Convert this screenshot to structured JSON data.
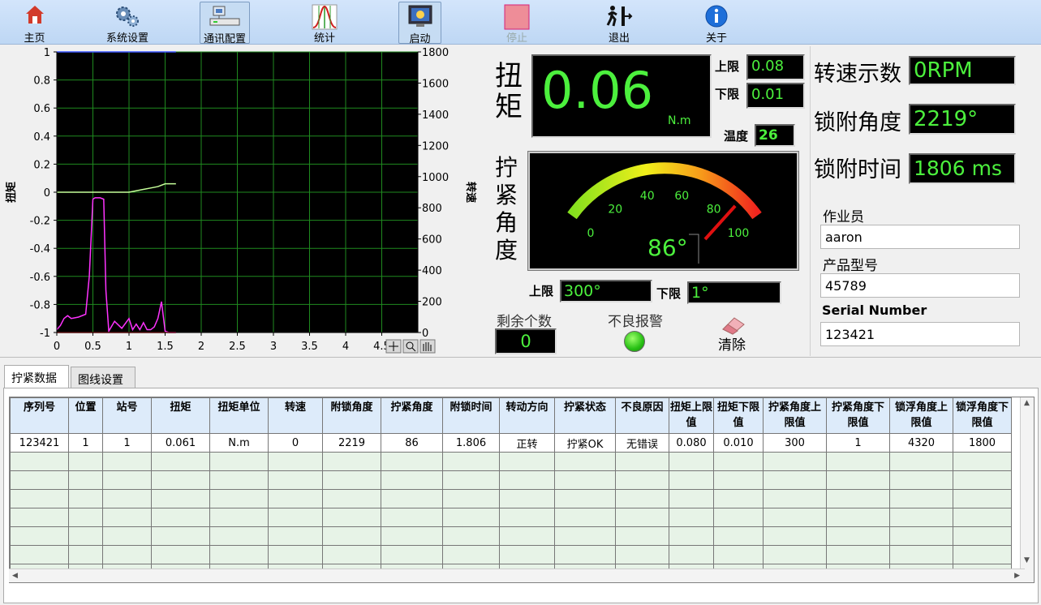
{
  "toolbar": {
    "items": [
      {
        "label": "主页",
        "icon": "home-icon"
      },
      {
        "label": "系统设置",
        "icon": "gears-icon"
      },
      {
        "label": "通讯配置",
        "icon": "network-config-icon"
      },
      {
        "label": "统计",
        "icon": "statistics-icon"
      },
      {
        "label": "启动",
        "icon": "start-monitor-icon"
      },
      {
        "label": "停止",
        "icon": "stop-icon"
      },
      {
        "label": "退出",
        "icon": "exit-icon"
      },
      {
        "label": "关于",
        "icon": "info-icon"
      }
    ]
  },
  "chart_data": {
    "type": "line",
    "xlabel": "",
    "ylabel": "扭矩",
    "y2label": "转速",
    "xlim": [
      0,
      5
    ],
    "ylim": [
      -1,
      1
    ],
    "y2lim": [
      0,
      1800
    ],
    "x_ticks": [
      "0",
      "0.5",
      "1",
      "1.5",
      "2",
      "2.5",
      "3",
      "3.5",
      "4",
      "4.5"
    ],
    "y_ticks": [
      "1",
      "0.8",
      "0.6",
      "0.4",
      "0.2",
      "0",
      "-0.2",
      "-0.4",
      "-0.6",
      "-0.8",
      "-1"
    ],
    "y2_ticks": [
      "1800",
      "1600",
      "1400",
      "1200",
      "1000",
      "800",
      "600",
      "400",
      "200",
      "0"
    ],
    "grid": true,
    "background": "#000000",
    "series": [
      {
        "color": "#c6ff9a",
        "axis": "left",
        "x": [
          0,
          0.3,
          0.5,
          0.7,
          0.85,
          1.0,
          1.1,
          1.2,
          1.3,
          1.4,
          1.5,
          1.55,
          1.65
        ],
        "y": [
          0.0,
          0.0,
          0.0,
          0.0,
          0.0,
          0.0,
          0.01,
          0.02,
          0.03,
          0.04,
          0.06,
          0.06,
          0.06
        ]
      },
      {
        "color": "#ff33ff",
        "axis": "left",
        "x": [
          0,
          0.05,
          0.1,
          0.15,
          0.2,
          0.3,
          0.4,
          0.45,
          0.5,
          0.53,
          0.6,
          0.65,
          0.68,
          0.72,
          0.8,
          0.9,
          1.0,
          1.05,
          1.1,
          1.15,
          1.2,
          1.25,
          1.3,
          1.35,
          1.4,
          1.45,
          1.5,
          1.55,
          1.6,
          1.65
        ],
        "y": [
          -0.98,
          -0.95,
          -0.9,
          -0.88,
          -0.9,
          -0.89,
          -0.87,
          -0.6,
          -0.05,
          -0.04,
          -0.04,
          -0.05,
          -0.7,
          -0.99,
          -0.92,
          -0.97,
          -0.9,
          -0.98,
          -0.94,
          -0.98,
          -0.93,
          -0.98,
          -0.98,
          -0.96,
          -0.9,
          -0.78,
          -0.99,
          -1.0,
          -1.0,
          -1.0
        ]
      },
      {
        "color": "#ff2a2a",
        "axis": "left",
        "x": [
          0,
          1.65
        ],
        "y": [
          -1.0,
          -1.0
        ]
      },
      {
        "color": "#3a57ff",
        "axis": "left",
        "x": [
          0,
          1.65
        ],
        "y": [
          1.0,
          1.0
        ]
      }
    ]
  },
  "torque": {
    "label": "扭矩",
    "value": "0.06",
    "unit": "N.m",
    "upper_label": "上限",
    "upper_value": "0.08",
    "lower_label": "下限",
    "lower_value": "0.01",
    "temp_label": "温度",
    "temp_value": "26"
  },
  "angle": {
    "label": "拧紧角度",
    "gauge_value": 86,
    "gauge_text": "86°",
    "gauge_ticks": [
      "0",
      "20",
      "40",
      "60",
      "80",
      "100"
    ],
    "upper_label": "上限",
    "upper_value": "300°",
    "lower_label": "下限",
    "lower_value": "1°"
  },
  "remaining": {
    "label": "剩余个数",
    "value": "0"
  },
  "alarm": {
    "label": "不良报警",
    "color": "#3ddc1a"
  },
  "clear": {
    "label": "清除",
    "icon": "eraser-icon"
  },
  "stats": {
    "speed_label": "转速示数",
    "speed_value": "0RPM",
    "lock_angle_label": "锁附角度",
    "lock_angle_value": "2219°",
    "lock_time_label": "锁附时间",
    "lock_time_value": "1806 ms"
  },
  "form": {
    "operator_label": "作业员",
    "operator_value": "aaron",
    "product_label": "产品型号",
    "product_value": "45789",
    "serial_label": "Serial Number",
    "serial_value": "123421"
  },
  "tabs": [
    {
      "label": "拧紧数据"
    },
    {
      "label": "图线设置"
    }
  ],
  "table": {
    "headers": [
      "序列号",
      "位置",
      "站号",
      "扭矩",
      "扭矩单位",
      "转速",
      "附锁角度",
      "拧紧角度",
      "附锁时间",
      "转动方向",
      "拧紧状态",
      "不良原因",
      "扭矩上限值",
      "扭矩下限值",
      "拧紧角度上限值",
      "拧紧角度下限值",
      "锁浮角度上限值",
      "锁浮角度下限值"
    ],
    "rows": [
      [
        "123421",
        "1",
        "1",
        "0.061",
        "N.m",
        "0",
        "2219",
        "86",
        "1.806",
        "正转",
        "拧紧OK",
        "无错误",
        "0.080",
        "0.010",
        "300",
        "1",
        "4320",
        "1800"
      ]
    ],
    "empty_rows": 7
  }
}
